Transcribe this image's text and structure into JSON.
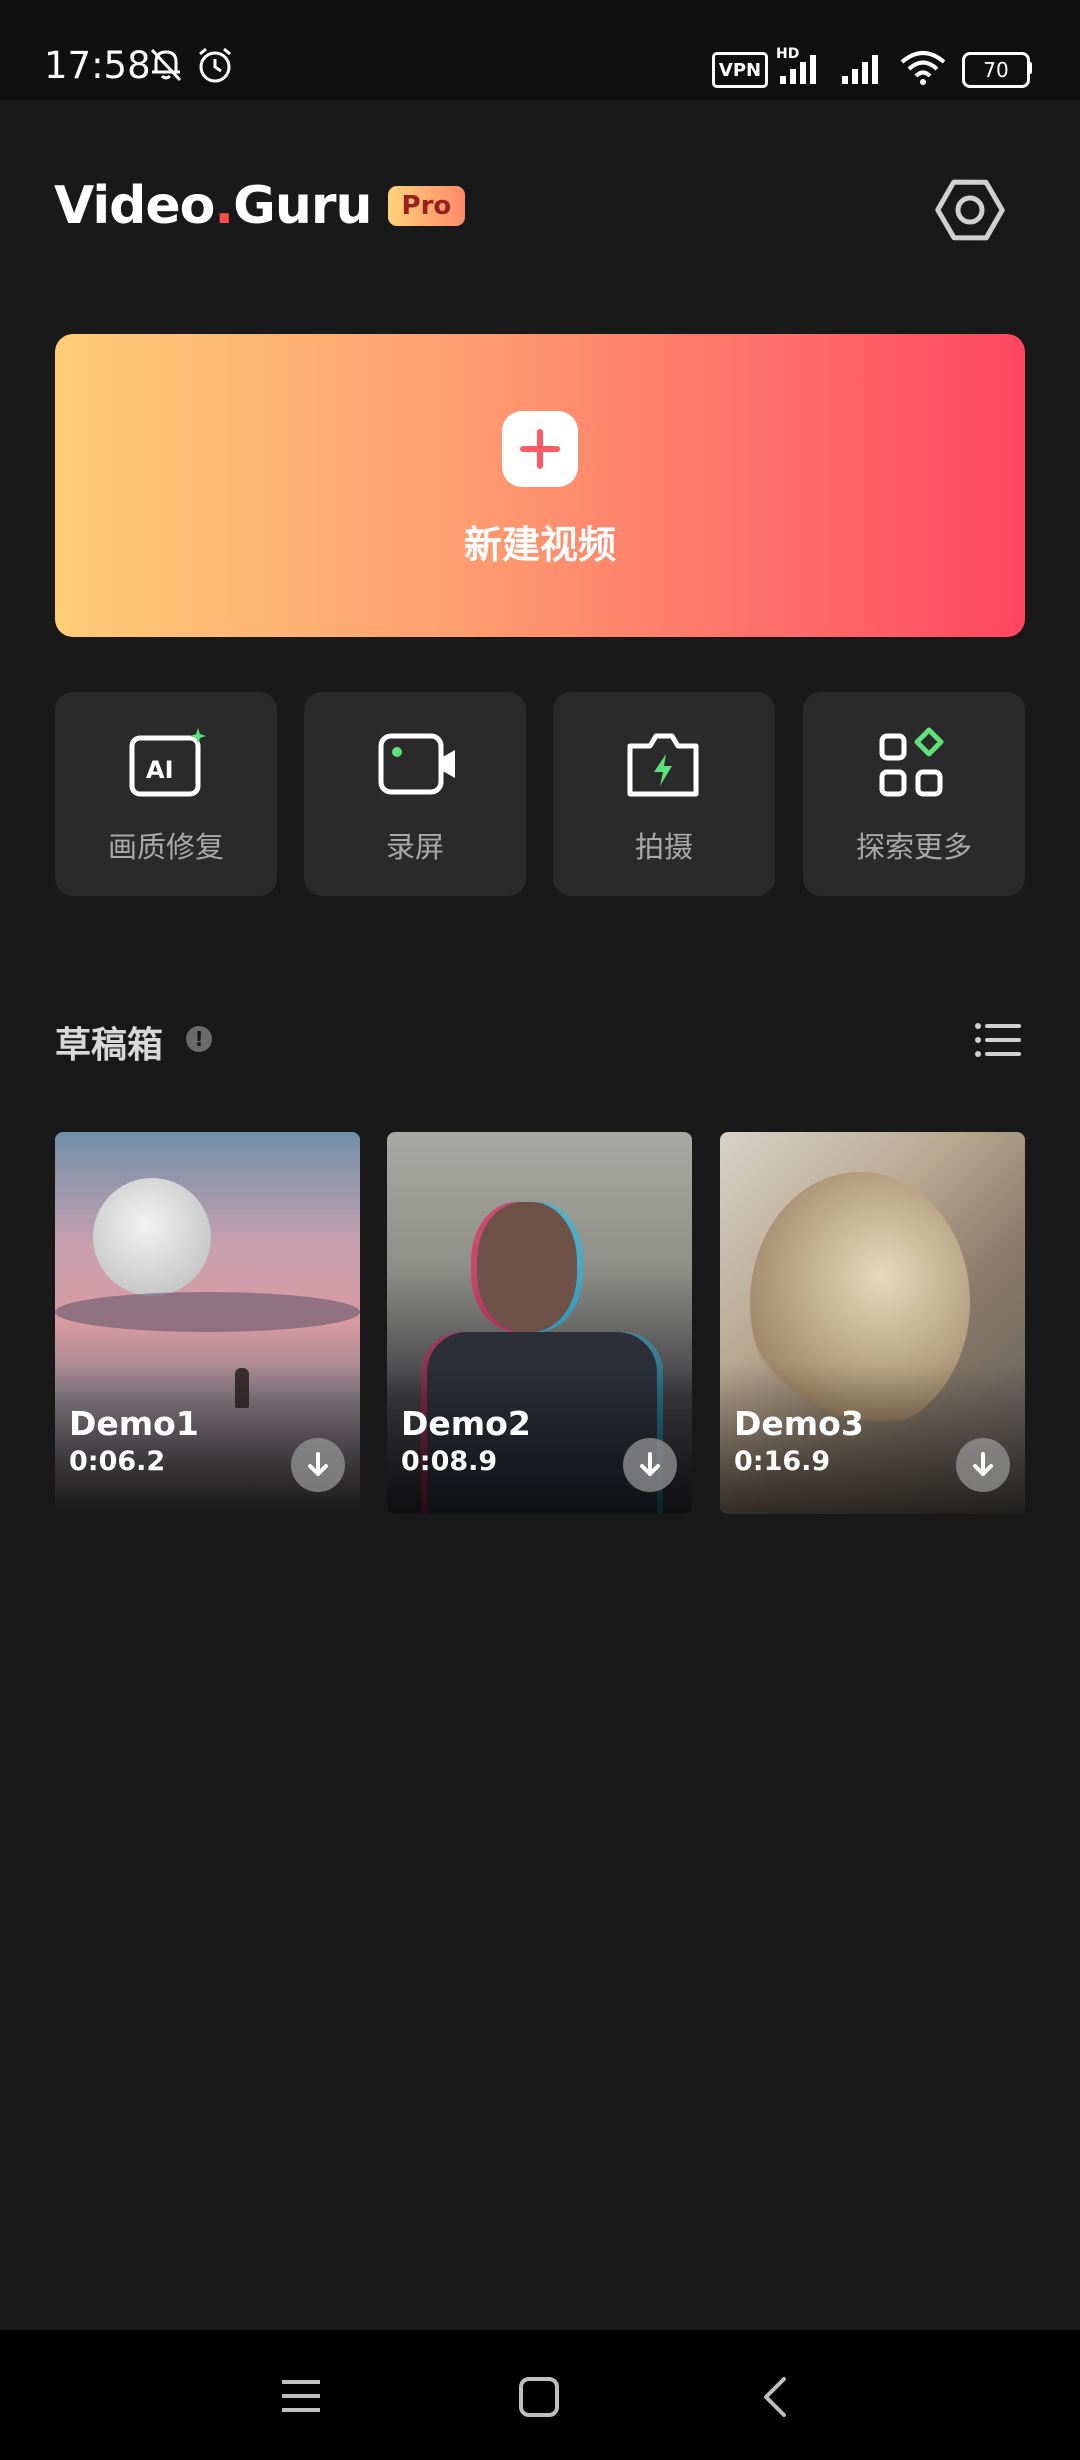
{
  "status_bar": {
    "time": "17:58",
    "vpn_label": "VPN",
    "network_label": "HD",
    "battery_level": "70",
    "icons": [
      "mute-bell-icon",
      "alarm-clock-icon",
      "signal-icon",
      "wifi-icon",
      "battery-icon"
    ]
  },
  "header": {
    "logo_part1": "Video",
    "logo_dot": ".",
    "logo_part2": "Guru",
    "pro_badge": "Pro",
    "settings_icon": "gear-icon"
  },
  "new_video": {
    "label": "新建视频",
    "icon": "plus-icon"
  },
  "tools": [
    {
      "label": "画质修复",
      "icon": "ai-enhance-icon"
    },
    {
      "label": "录屏",
      "icon": "screen-record-icon"
    },
    {
      "label": "拍摄",
      "icon": "camera-icon"
    },
    {
      "label": "探索更多",
      "icon": "explore-more-icon"
    }
  ],
  "drafts": {
    "title": "草稿箱",
    "info_icon": "info-icon",
    "view_icon": "list-view-icon",
    "items": [
      {
        "name": "Demo1",
        "duration": "0:06.2",
        "icon": "download-icon"
      },
      {
        "name": "Demo2",
        "duration": "0:08.9",
        "icon": "download-icon"
      },
      {
        "name": "Demo3",
        "duration": "0:16.9",
        "icon": "download-icon"
      }
    ]
  },
  "nav_bar": {
    "icons": [
      "menu-icon",
      "home-icon",
      "back-icon"
    ]
  },
  "colors": {
    "background": "#191919",
    "card": "#2a2a2a",
    "gradient_start": "#ffcd78",
    "gradient_end": "#ff4560",
    "accent_red": "#ff4b4b"
  }
}
